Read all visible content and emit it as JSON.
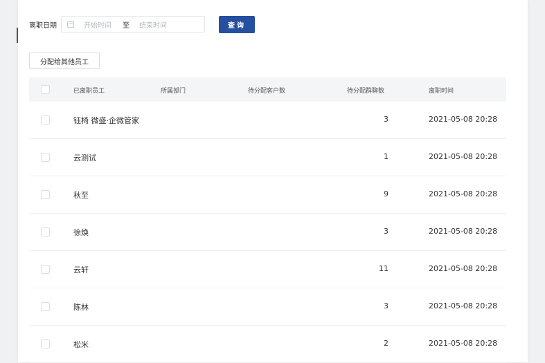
{
  "filter": {
    "label": "离职日期",
    "start_placeholder": "开始时间",
    "separator": "至",
    "end_placeholder": "结束时间",
    "query_label": "查询"
  },
  "toolbar": {
    "assign_label": "分配给其他员工"
  },
  "table": {
    "headers": {
      "employee": "已离职员工",
      "department": "所属部门",
      "pending_customers": "待分配客户数",
      "pending_groups": "待分配群聊数",
      "leave_time": "离职时间"
    },
    "rows": [
      {
        "employee": "钰椅 微盛·企微管家",
        "department": "",
        "pending_customers": "",
        "pending_groups": "3",
        "leave_time": "2021-05-08 20:28"
      },
      {
        "employee": "云测试",
        "department": "",
        "pending_customers": "",
        "pending_groups": "1",
        "leave_time": "2021-05-08 20:28"
      },
      {
        "employee": "秋至",
        "department": "",
        "pending_customers": "",
        "pending_groups": "9",
        "leave_time": "2021-05-08 20:28"
      },
      {
        "employee": "徐焕",
        "department": "",
        "pending_customers": "",
        "pending_groups": "3",
        "leave_time": "2021-05-08 20:28"
      },
      {
        "employee": "云轩",
        "department": "",
        "pending_customers": "",
        "pending_groups": "11",
        "leave_time": "2021-05-08 20:28"
      },
      {
        "employee": "陈林",
        "department": "",
        "pending_customers": "",
        "pending_groups": "3",
        "leave_time": "2021-05-08 20:28"
      },
      {
        "employee": "松米",
        "department": "",
        "pending_customers": "",
        "pending_groups": "2",
        "leave_time": "2021-05-08 20:28"
      }
    ]
  }
}
